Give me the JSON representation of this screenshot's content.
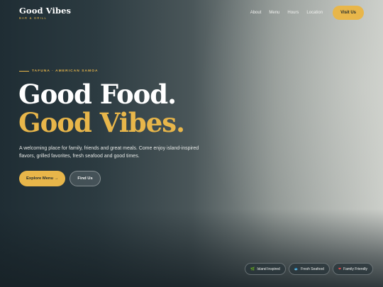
{
  "brand": {
    "name": "Good Vibes",
    "tagline": "BAR & GRILL"
  },
  "nav": {
    "items": [
      {
        "label": "About"
      },
      {
        "label": "Menu"
      },
      {
        "label": "Hours"
      },
      {
        "label": "Location"
      }
    ],
    "cta_label": "Visit Us"
  },
  "hero": {
    "eyebrow": "TAFUNA · AMERICAN SAMOA",
    "headline_line1": "Good Food.",
    "headline_line2": "Good Vibes.",
    "intro": "A welcoming place for family, friends and great meals. Come enjoy island-inspired flavors, grilled favorites, fresh seafood and good times.",
    "primary_cta": "Explore Menu →",
    "secondary_cta": "Find Us"
  },
  "badges": [
    {
      "label": "Island Inspired",
      "icon": "leaf-icon",
      "glyph": "🌿"
    },
    {
      "label": "Fresh Seafood",
      "icon": "fish-icon",
      "glyph": "🐟"
    },
    {
      "label": "Family Friendly",
      "icon": "heart-icon",
      "glyph": "❤"
    }
  ],
  "colors": {
    "accent": "#e8b64a",
    "dark": "#1f2a2e"
  }
}
